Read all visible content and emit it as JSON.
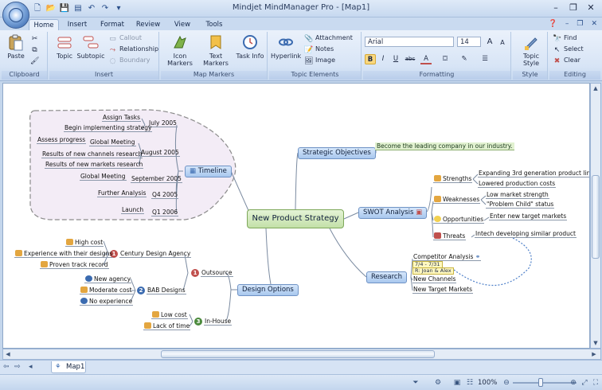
{
  "window": {
    "title": "Mindjet MindManager Pro - [Map1]",
    "controls": [
      "–",
      "❐",
      "✕"
    ]
  },
  "menu_tabs": [
    {
      "label": "Home",
      "active": true
    },
    {
      "label": "Insert",
      "active": false
    },
    {
      "label": "Format",
      "active": false
    },
    {
      "label": "Review",
      "active": false
    },
    {
      "label": "View",
      "active": false
    },
    {
      "label": "Tools",
      "active": false
    }
  ],
  "ribbon": {
    "clipboard": {
      "label": "Clipboard",
      "paste": "Paste"
    },
    "insert": {
      "label": "Insert",
      "topic": "Topic",
      "subtopic": "Subtopic",
      "callout": "Callout",
      "relationship": "Relationship",
      "boundary": "Boundary"
    },
    "map_markers": {
      "label": "Map Markers",
      "icon_markers": "Icon Markers",
      "text_markers": "Text Markers",
      "task_info": "Task Info"
    },
    "topic_elements": {
      "label": "Topic Elements",
      "hyperlink": "Hyperlink",
      "attachment": "Attachment",
      "notes": "Notes",
      "image": "Image"
    },
    "formatting": {
      "label": "Formatting",
      "font_name": "Arial",
      "font_size": "14",
      "grow": "A",
      "shrink": "A",
      "bold": "B",
      "italic": "I",
      "underline": "U",
      "strike": "abc",
      "font_color": "A"
    },
    "style": {
      "label": "Style",
      "topic_style": "Topic Style"
    },
    "editing": {
      "label": "Editing",
      "find": "Find",
      "select": "Select",
      "clear": "Clear"
    }
  },
  "map": {
    "central": "New Product Strategy",
    "main_topics": {
      "strategic": "Strategic Objectives",
      "swot": "SWOT Analysis",
      "research": "Research",
      "design": "Design Options",
      "timeline": "Timeline"
    },
    "strategic_note": "Become the leading company in our industry.",
    "swot": {
      "strengths": "Strengths",
      "weaknesses": "Weaknesses",
      "opportunities": "Opportunities",
      "threats": "Threats",
      "s1": "Expanding 3rd generation product line",
      "s2": "Lowered production costs",
      "w1": "Low market strength",
      "w2": "\"Problem Child\" status",
      "o1": "Enter new target markets",
      "t1": "Intech developing similar product"
    },
    "research": {
      "competitor": "Competitor Analysis",
      "tag_date": "7/4 - 7/31",
      "tag_people": "R: Joan & Alex",
      "channels": "New Channels",
      "markets": "New Target Markets"
    },
    "timeline": {
      "july": "July 2005",
      "assign": "Assign Tasks",
      "begin": "Begin implementing strategy",
      "august": "August 2005",
      "assess": "Assess progress",
      "global1": "Global Meeting",
      "results1": "Results of new channels research",
      "results2": "Results of new markets research",
      "september": "September 2005",
      "global2": "Global Meeting",
      "q4": "Q4 2005",
      "further": "Further Analysis",
      "q1": "Q1 2006",
      "launch": "Launch"
    },
    "design": {
      "outsource": "Outsource",
      "inhouse": "In-House",
      "century": "Century Design Agency",
      "bab": "BAB Designs",
      "high_cost": "High cost",
      "experience": "Experience with their designs",
      "proven": "Proven track record",
      "new_agency": "New agency",
      "moderate": "Moderate cost",
      "no_exp": "No experience",
      "low_cost": "Low cost",
      "lack_time": "Lack of time",
      "n1": "1",
      "n2": "1",
      "n3": "2",
      "n4": "3"
    }
  },
  "sheet": {
    "tab_label": "Map1"
  },
  "status": {
    "zoom": "100%"
  }
}
